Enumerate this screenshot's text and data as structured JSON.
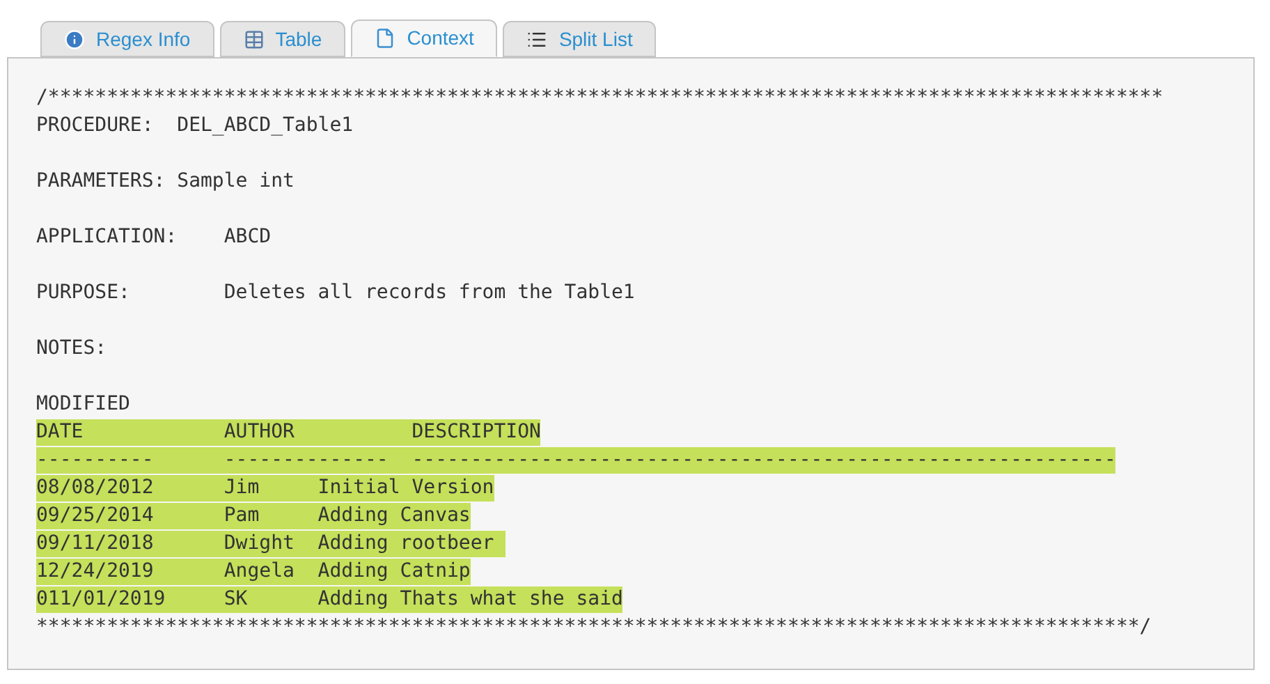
{
  "tabs": [
    {
      "label": "Regex Info",
      "selected": false
    },
    {
      "label": "Table",
      "selected": false
    },
    {
      "label": "Context",
      "selected": true
    },
    {
      "label": "Split List",
      "selected": false
    }
  ],
  "lines": [
    {
      "kind": "text",
      "text": "/***********************************************************************************************",
      "highlighted": false
    },
    {
      "kind": "text",
      "text": "PROCEDURE:  DEL_ABCD_Table1",
      "highlighted": false
    },
    {
      "kind": "blank"
    },
    {
      "kind": "text",
      "text": "PARAMETERS: Sample int",
      "highlighted": false
    },
    {
      "kind": "blank"
    },
    {
      "kind": "text",
      "text": "APPLICATION:    ABCD",
      "highlighted": false
    },
    {
      "kind": "blank"
    },
    {
      "kind": "text",
      "text": "PURPOSE:        Deletes all records from the Table1",
      "highlighted": false
    },
    {
      "kind": "blank"
    },
    {
      "kind": "text",
      "text": "NOTES:",
      "highlighted": false
    },
    {
      "kind": "blank"
    },
    {
      "kind": "text",
      "text": "MODIFIED",
      "highlighted": false
    },
    {
      "kind": "text",
      "text": "DATE            AUTHOR          DESCRIPTION",
      "highlighted": true
    },
    {
      "kind": "text",
      "text": "----------      --------------  ------------------------------------------------------------",
      "highlighted": true
    },
    {
      "kind": "text",
      "text": "08/08/2012      Jim     Initial Version",
      "highlighted": true
    },
    {
      "kind": "text",
      "text": "09/25/2014      Pam     Adding Canvas",
      "highlighted": true
    },
    {
      "kind": "text",
      "text": "09/11/2018      Dwight  Adding rootbeer ",
      "highlighted": true
    },
    {
      "kind": "text",
      "text": "12/24/2019      Angela  Adding Catnip",
      "highlighted": true
    },
    {
      "kind": "text",
      "text": "011/01/2019     SK      Adding Thats what she said",
      "highlighted": true
    },
    {
      "kind": "text",
      "text": "**********************************************************************************************/",
      "highlighted": false
    }
  ]
}
